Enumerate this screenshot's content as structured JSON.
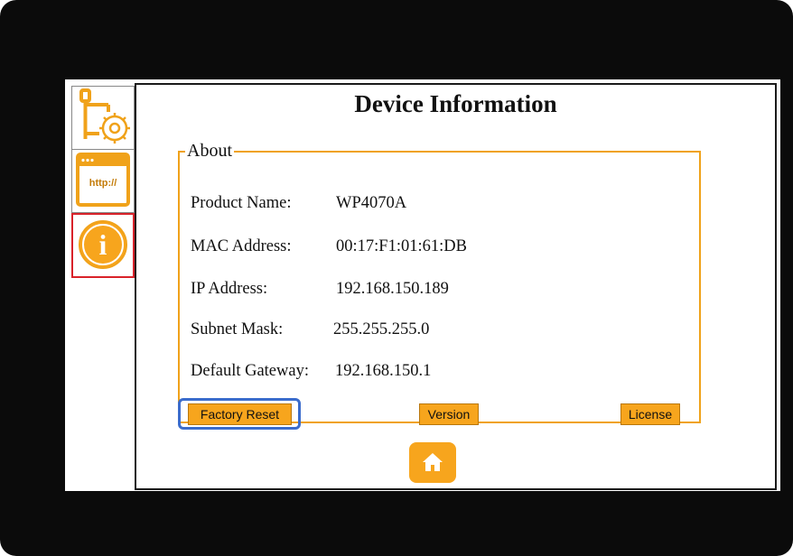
{
  "window": {
    "title": "Device Information"
  },
  "sidebar": {
    "items": [
      {
        "icon": "network-settings-icon",
        "label": ""
      },
      {
        "icon": "http-browser-icon",
        "label": "http://"
      },
      {
        "icon": "info-icon",
        "label": "i",
        "active": true
      }
    ]
  },
  "about": {
    "legend": "About",
    "fields": [
      {
        "label": "Product Name:",
        "value": "WP4070A"
      },
      {
        "label": "MAC Address:",
        "value": "00:17:F1:01:61:DB"
      },
      {
        "label": "IP Address:",
        "value": "192.168.150.189"
      },
      {
        "label": "Subnet Mask:",
        "value": "255.255.255.0"
      },
      {
        "label": "Default Gateway:",
        "value": "192.168.150.1"
      }
    ]
  },
  "buttons": {
    "factory_reset": "Factory Reset",
    "version": "Version",
    "license": "License",
    "home_icon": "home-icon"
  },
  "colors": {
    "accent": "#f7a51d",
    "active_border": "#d9222a",
    "focus": "#3b6ccc"
  }
}
